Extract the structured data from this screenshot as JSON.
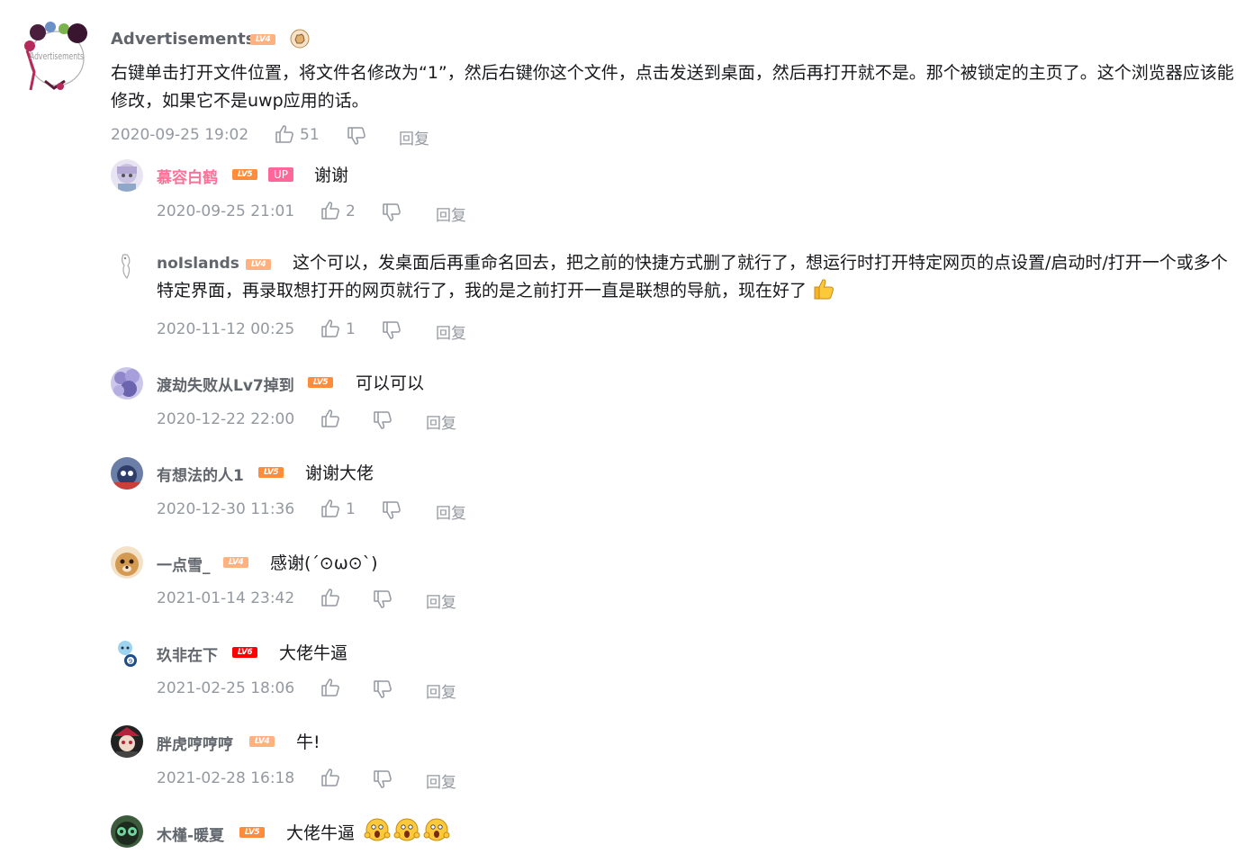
{
  "root": {
    "username": "Advertisements",
    "level": "LV4",
    "text": "右键单击打开文件位置，将文件名修改为“1”，然后右键你这个文件，点击发送到桌面，然后再打开就不是。那个被锁定的主页了。这个浏览器应该能修改，如果它不是uwp应用的话。",
    "time": "2020-09-25 19:02",
    "likes": "51",
    "reply_label": "回复",
    "avatar_text": "Advertisements"
  },
  "replies": [
    {
      "username": "慕容白鹤",
      "level": "LV5",
      "is_up": true,
      "up_label": "UP",
      "text": "谢谢",
      "time": "2020-09-25 21:01",
      "likes": "2",
      "reply_label": "回复"
    },
    {
      "username": "noIslands",
      "level": "LV4",
      "text": "这个可以，发桌面后再重命名回去，把之前的快捷方式删了就行了，想运行时打开特定网页的点设置/启动时/打开一个或多个特定界面，再录取想打开的网页就行了，我的是之前打开一直是联想的导航，现在好了",
      "time": "2020-11-12 00:25",
      "likes": "1",
      "reply_label": "回复"
    },
    {
      "username": "渡劫失败从Lv7掉到",
      "level": "LV5",
      "text": "可以可以",
      "time": "2020-12-22 22:00",
      "likes": "",
      "reply_label": "回复"
    },
    {
      "username": "有想法的人1",
      "level": "LV5",
      "text": "谢谢大佬",
      "time": "2020-12-30 11:36",
      "likes": "1",
      "reply_label": "回复"
    },
    {
      "username": "一点雪_",
      "level": "LV4",
      "text": "感谢(´⊙ω⊙`)",
      "time": "2021-01-14 23:42",
      "likes": "",
      "reply_label": "回复"
    },
    {
      "username": "玖非在下",
      "level": "LV6",
      "text": "大佬牛逼",
      "time": "2021-02-25 18:06",
      "likes": "",
      "reply_label": "回复"
    },
    {
      "username": "胖虎哼哼哼",
      "level": "LV4",
      "text": "牛!",
      "time": "2021-02-28 16:18",
      "likes": "",
      "reply_label": "回复"
    },
    {
      "username": "木槿-暖夏",
      "level": "LV5",
      "text": "大佬牛逼",
      "time": "",
      "likes": "",
      "reply_label": ""
    }
  ],
  "colors": {
    "username_default": "#61666d",
    "username_vip": "#fb7299",
    "meta": "#9499a0",
    "lv4": "#ffb27f",
    "lv5": "#ff8c3b",
    "lv6": "#ff0000",
    "up": "#ff6699"
  },
  "icons": {
    "like": "thumbs-up-icon",
    "dislike": "thumbs-down-icon",
    "emoji_thumb": "thumbs-up-emoji-icon",
    "emoji_shock": "shocked-face-emoji-icon",
    "root_badge": "fist-badge-icon"
  }
}
